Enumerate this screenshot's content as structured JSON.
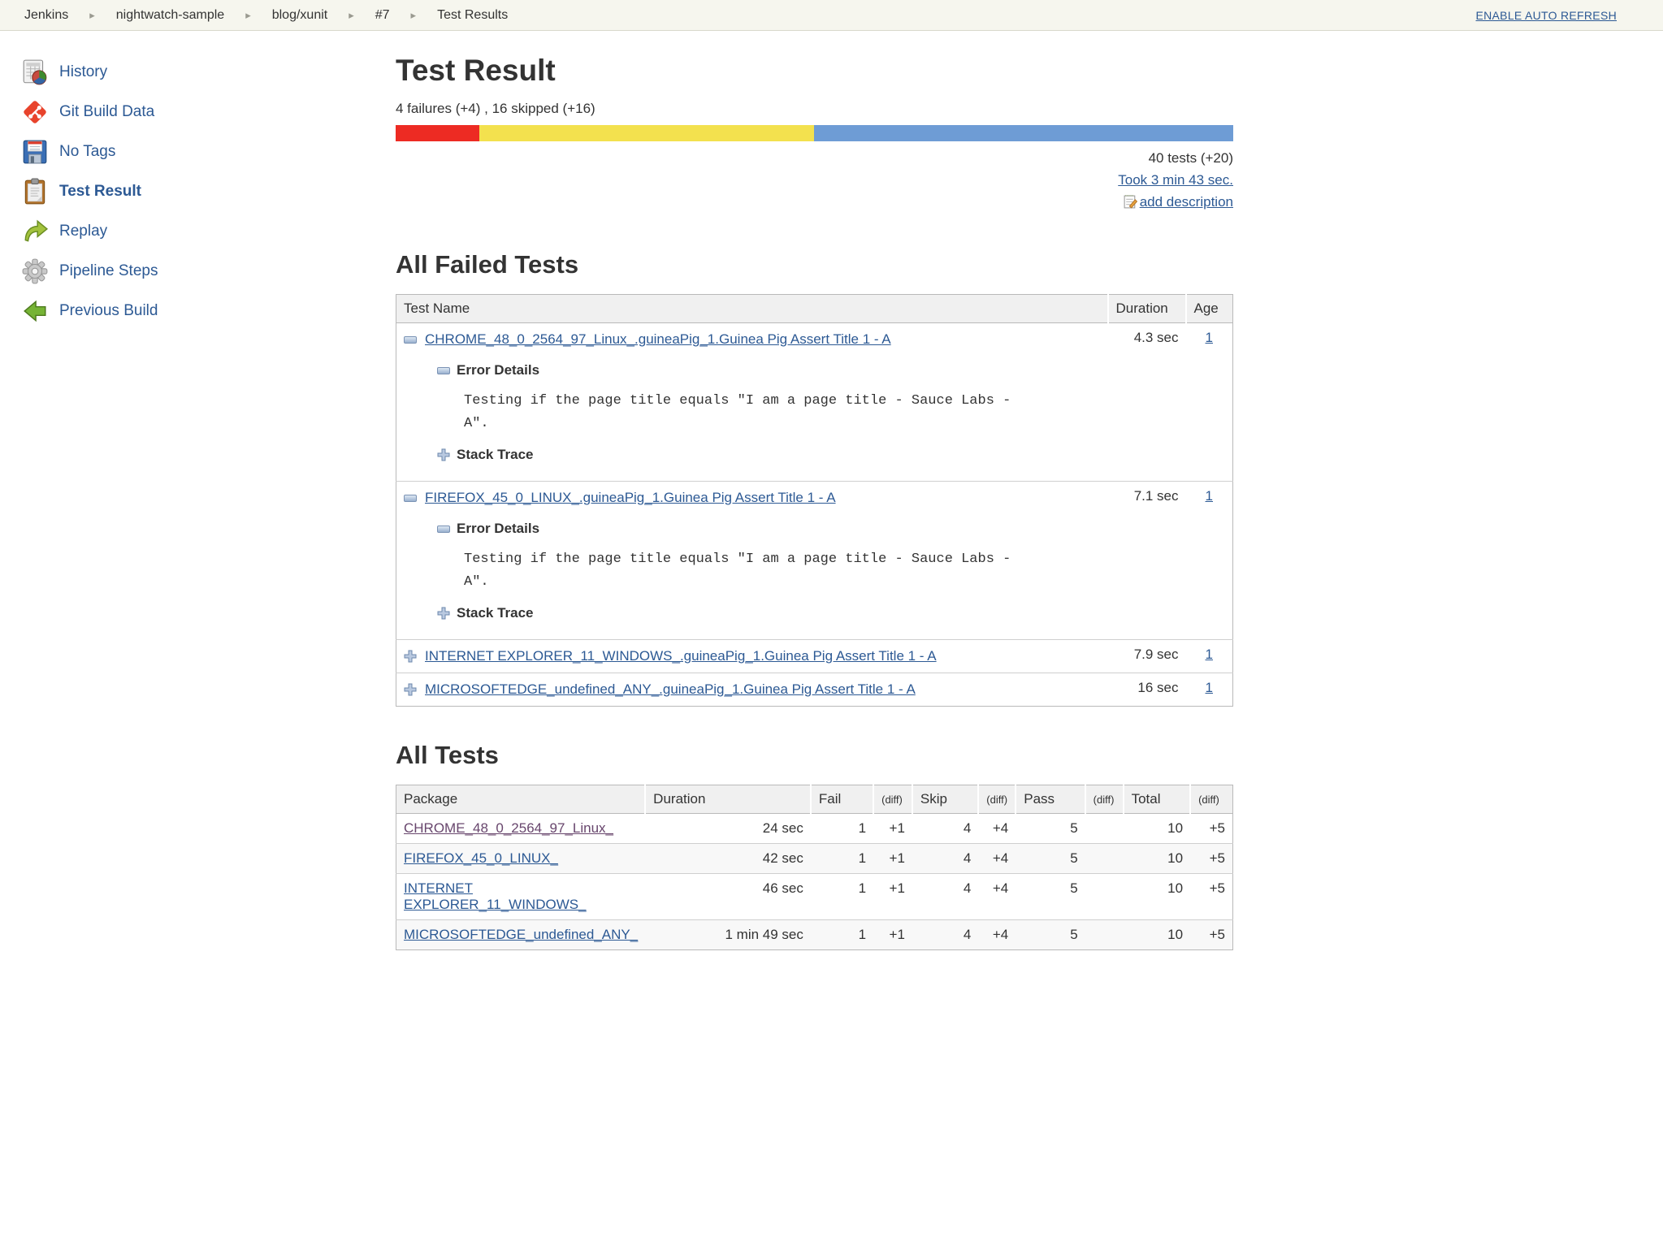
{
  "colors": {
    "link_blue": "#2c5994",
    "visited_purple": "#68466d",
    "bar_fail_red": "#ed2b23",
    "bar_skip_yellow": "#f3e14e",
    "bar_pass_blue": "#6e9cd5",
    "topbar_bg": "#f6f6ee",
    "table_header_bg": "#f0f0f0"
  },
  "topbar": {
    "breadcrumb": [
      "Jenkins",
      "nightwatch-sample",
      "blog/xunit",
      "#7",
      "Test Results"
    ],
    "auto_refresh": "ENABLE AUTO REFRESH"
  },
  "sidebar": {
    "items": [
      {
        "label": "History",
        "icon": "history-icon"
      },
      {
        "label": "Git Build Data",
        "icon": "git-icon"
      },
      {
        "label": "No Tags",
        "icon": "save-icon"
      },
      {
        "label": "Test Result",
        "icon": "clipboard-icon"
      },
      {
        "label": "Replay",
        "icon": "replay-icon"
      },
      {
        "label": "Pipeline Steps",
        "icon": "gear-icon"
      },
      {
        "label": "Previous Build",
        "icon": "previous-build-icon"
      }
    ]
  },
  "header": {
    "title": "Test Result",
    "failures_line": "4 failures (+4) , 16 skipped (+16)",
    "bar": {
      "fail_pct": 10,
      "skip_pct": 40,
      "pass_pct": 50
    },
    "tests_count": "40 tests (+20)",
    "took": "Took 3 min 43 sec.",
    "add_description": "add description"
  },
  "failed_tests": {
    "heading": "All Failed Tests",
    "columns": {
      "name": "Test Name",
      "duration": "Duration",
      "age": "Age"
    },
    "labels": {
      "error_details": "Error Details",
      "stack_trace": "Stack Trace"
    },
    "rows": [
      {
        "name": "CHROME_48_0_2564_97_Linux_.guineaPig_1.Guinea Pig Assert Title 1 - A",
        "duration": "4.3 sec",
        "age": "1",
        "expanded": true,
        "error_text": "Testing if the page title equals \"I am a page title - Sauce Labs - A\"."
      },
      {
        "name": "FIREFOX_45_0_LINUX_.guineaPig_1.Guinea Pig Assert Title 1 - A",
        "duration": "7.1 sec",
        "age": "1",
        "expanded": true,
        "error_text": "Testing if the page title equals \"I am a page title - Sauce Labs - A\"."
      },
      {
        "name": "INTERNET EXPLORER_11_WINDOWS_.guineaPig_1.Guinea Pig Assert Title 1 - A",
        "duration": "7.9 sec",
        "age": "1",
        "expanded": false
      },
      {
        "name": "MICROSOFTEDGE_undefined_ANY_.guineaPig_1.Guinea Pig Assert Title 1 - A",
        "duration": "16 sec",
        "age": "1",
        "expanded": false
      }
    ]
  },
  "all_tests": {
    "heading": "All Tests",
    "columns": [
      "Package",
      "Duration",
      "Fail",
      "(diff)",
      "Skip",
      "(diff)",
      "Pass",
      "(diff)",
      "Total",
      "(diff)"
    ],
    "rows": [
      {
        "package": "CHROME_48_0_2564_97_Linux_",
        "duration": "24 sec",
        "fail": "1",
        "fail_diff": "+1",
        "skip": "4",
        "skip_diff": "+4",
        "pass": "5",
        "pass_diff": "",
        "total": "10",
        "total_diff": "+5"
      },
      {
        "package": "FIREFOX_45_0_LINUX_",
        "duration": "42 sec",
        "fail": "1",
        "fail_diff": "+1",
        "skip": "4",
        "skip_diff": "+4",
        "pass": "5",
        "pass_diff": "",
        "total": "10",
        "total_diff": "+5"
      },
      {
        "package": "INTERNET EXPLORER_11_WINDOWS_",
        "duration": "46 sec",
        "fail": "1",
        "fail_diff": "+1",
        "skip": "4",
        "skip_diff": "+4",
        "pass": "5",
        "pass_diff": "",
        "total": "10",
        "total_diff": "+5"
      },
      {
        "package": "MICROSOFTEDGE_undefined_ANY_",
        "duration": "1 min 49 sec",
        "fail": "1",
        "fail_diff": "+1",
        "skip": "4",
        "skip_diff": "+4",
        "pass": "5",
        "pass_diff": "",
        "total": "10",
        "total_diff": "+5"
      }
    ]
  }
}
